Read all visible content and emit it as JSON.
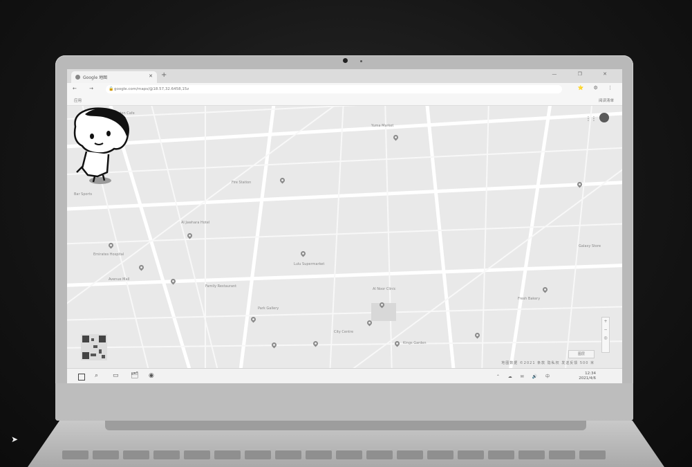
{
  "browser": {
    "tab_title": "Google 地图",
    "close_glyph": "✕",
    "new_tab_glyph": "+",
    "window_controls": "—  ❐  ✕",
    "nav_glyphs": "←  →  ⟳",
    "address": "google.com/maps/@18.57,32.6458,15z",
    "right_icons": "⭐ ⚙ ⋮",
    "bookmarks_left": "应用",
    "bookmarks_right": "阅读清单"
  },
  "map": {
    "labels": [
      "Olive Garden Cafe",
      "Yuma Market",
      "Bar Sports",
      "Fire Station",
      "Al Jawhara Hotel",
      "Emirates Hospital",
      "Avenue Mall",
      "Lulu Supermarket",
      "Al Noor Clinic",
      "Family Restaurant",
      "Park Gallery",
      "City Centre",
      "Kings Garden",
      "Fresh Bakery",
      "Galaxy Store"
    ],
    "attribution": "地图数据 ©2021   条款   隐私权   发送反馈   500 米",
    "layers_label": "图层",
    "zoom_in": "+",
    "zoom_out": "−",
    "apps_glyph": "⋮⋮"
  },
  "taskbar": {
    "icons": [
      "⌕",
      "▭",
      "🗂",
      "◉"
    ],
    "tray": "⌃ ☁ ✉ 🔊 中",
    "time": "12:34",
    "date": "2021/4/6"
  }
}
